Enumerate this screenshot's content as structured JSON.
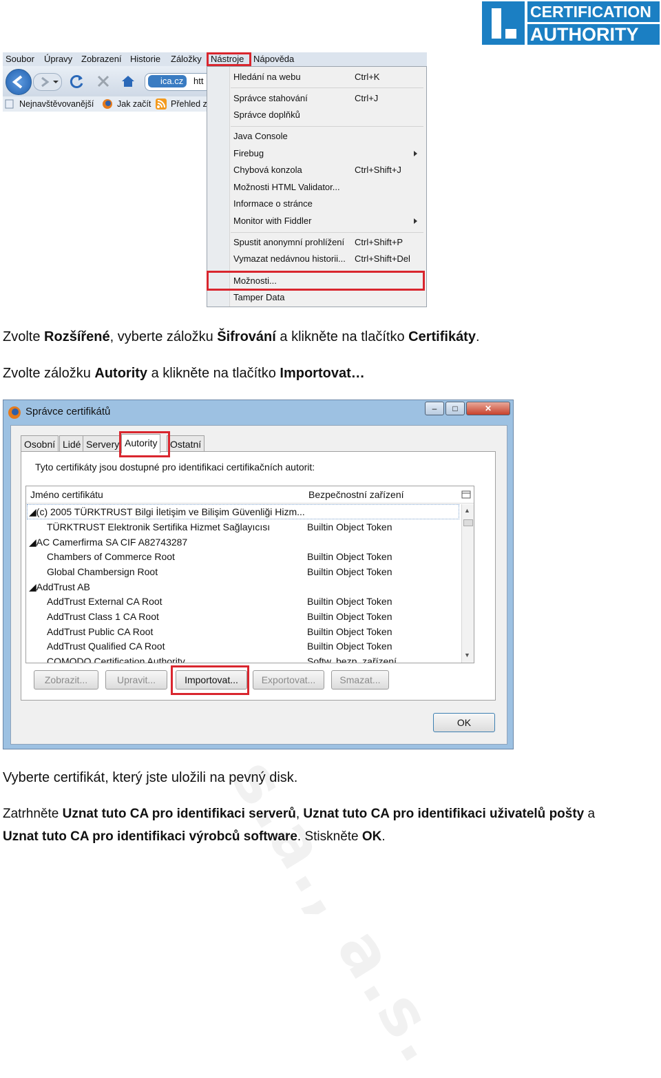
{
  "logo": {
    "line1": "CERTIFICATION",
    "line2": "AUTHORITY"
  },
  "browser": {
    "menu": [
      "Soubor",
      "Úpravy",
      "Zobrazení",
      "Historie",
      "Záložky",
      "Nástroje",
      "Nápověda"
    ],
    "address_fragment": "ica.cz",
    "address_text": "htt",
    "bookmarks": [
      "Nejnavštěvovanější",
      "Jak začít",
      "Přehled z"
    ],
    "dropdown": [
      {
        "label": "Hledání na webu",
        "shortcut": "Ctrl+K"
      },
      {
        "label": "Správce stahování",
        "shortcut": "Ctrl+J"
      },
      {
        "label": "Správce doplňků",
        "shortcut": ""
      },
      {
        "label": "Java Console",
        "shortcut": ""
      },
      {
        "label": "Firebug",
        "shortcut": ""
      },
      {
        "label": "Chybová konzola",
        "shortcut": "Ctrl+Shift+J"
      },
      {
        "label": "Možnosti HTML Validator...",
        "shortcut": ""
      },
      {
        "label": "Informace o stránce",
        "shortcut": ""
      },
      {
        "label": "Monitor with Fiddler",
        "shortcut": ""
      },
      {
        "label": "Spustit anonymní prohlížení",
        "shortcut": "Ctrl+Shift+P"
      },
      {
        "label": "Vymazat nedávnou historii...",
        "shortcut": "Ctrl+Shift+Del"
      },
      {
        "label": "Možnosti...",
        "shortcut": ""
      },
      {
        "label": "Tamper Data",
        "shortcut": ""
      }
    ]
  },
  "text": {
    "p1": {
      "a": "Zvolte ",
      "b": "Rozšířené",
      "c": ", vyberte záložku ",
      "d": "Šifrování",
      "e": " a klikněte na tlačítko ",
      "f": "Certifikáty",
      "g": "."
    },
    "p2": {
      "a": "Zvolte záložku ",
      "b": "Autority",
      "c": " a klikněte na tlačítko ",
      "d": "Importovat…"
    },
    "p3": "Vyberte certifikát, který jste uložili na pevný disk.",
    "p4": {
      "a": "Zatrhněte ",
      "b": "Uznat tuto CA pro identifikaci serverů",
      "c": ", ",
      "d": "Uznat tuto CA pro identifikaci uživatelů pošty",
      "e": " a"
    },
    "p5": {
      "a": "Uznat tuto CA pro identifikaci výrobců software",
      "b": ". Stiskněte ",
      "c": "OK",
      "d": "."
    }
  },
  "dialog": {
    "title": "Správce certifikátů",
    "tabs": [
      "Osobní",
      "Lidé",
      "Servery",
      "Autority",
      "Ostatní"
    ],
    "description": "Tyto certifikáty jsou dostupné pro identifikaci certifikačních autorit:",
    "col1": "Jméno certifikátu",
    "col2": "Bezpečnostní zařízení",
    "rows": [
      {
        "name": "(c) 2005 TÜRKTRUST Bilgi İletişim ve Bilişim Güvenliği Hizm...",
        "device": "",
        "group": true
      },
      {
        "name": "TÜRKTRUST Elektronik Sertifika Hizmet Sağlayıcısı",
        "device": "Builtin Object Token",
        "group": false
      },
      {
        "name": "AC Camerfirma SA CIF A82743287",
        "device": "",
        "group": true
      },
      {
        "name": "Chambers of Commerce Root",
        "device": "Builtin Object Token",
        "group": false
      },
      {
        "name": "Global Chambersign Root",
        "device": "Builtin Object Token",
        "group": false
      },
      {
        "name": "AddTrust AB",
        "device": "",
        "group": true
      },
      {
        "name": "AddTrust External CA Root",
        "device": "Builtin Object Token",
        "group": false
      },
      {
        "name": "AddTrust Class 1 CA Root",
        "device": "Builtin Object Token",
        "group": false
      },
      {
        "name": "AddTrust Public CA Root",
        "device": "Builtin Object Token",
        "group": false
      },
      {
        "name": "AddTrust Qualified CA Root",
        "device": "Builtin Object Token",
        "group": false
      },
      {
        "name": "COMODO Certification Authority",
        "device": "Softw. bezp. zařízení",
        "group": false
      }
    ],
    "buttons": {
      "view": "Zobrazit...",
      "edit": "Upravit...",
      "import": "Importovat...",
      "export": "Exportovat...",
      "delete": "Smazat...",
      "ok": "OK"
    }
  },
  "watermark": "vnitřní, s.a., a.s."
}
